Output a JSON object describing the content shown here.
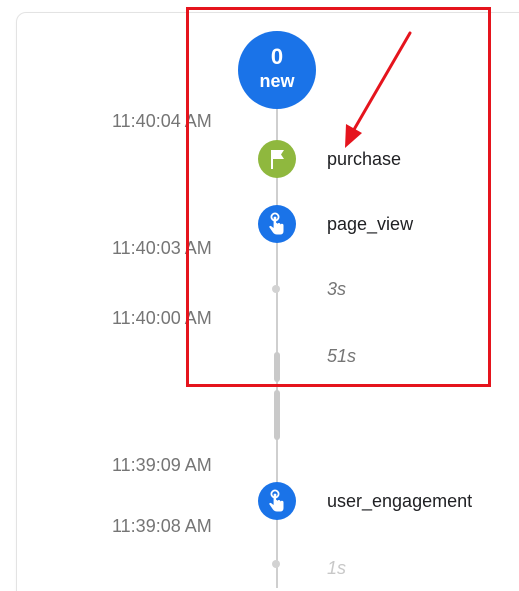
{
  "badge": {
    "count": "0",
    "label": "new"
  },
  "timestamps": [
    "11:40:04 AM",
    "11:40:03 AM",
    "11:40:00 AM",
    "11:39:09 AM",
    "11:39:08 AM"
  ],
  "events": [
    {
      "label": "purchase",
      "icon": "flag-icon"
    },
    {
      "label": "page_view",
      "icon": "touch-hand-icon"
    },
    {
      "label": "user_engagement",
      "icon": "touch-hand-icon"
    }
  ],
  "durations": [
    "3s",
    "51s",
    "1s"
  ],
  "colors": {
    "badge_blue": "#1a73e8",
    "event_green": "#8fb83e",
    "annotation_red": "#e5141d"
  }
}
